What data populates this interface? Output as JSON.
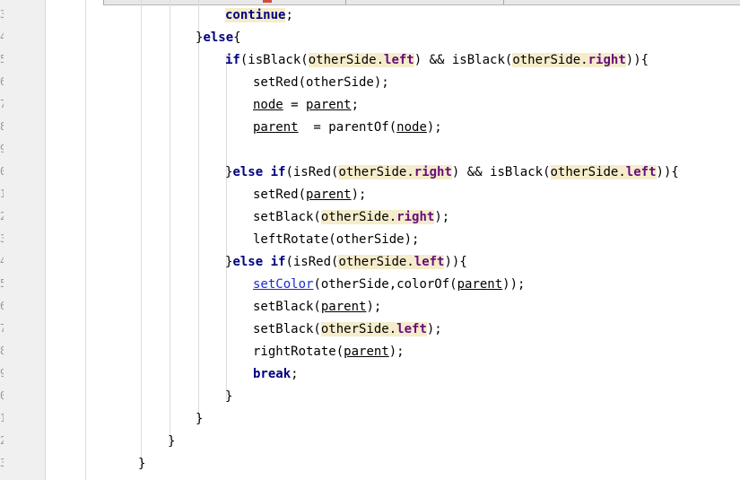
{
  "editor": {
    "gutter": {
      "line_numbers": [
        "3",
        "4",
        "5",
        "6",
        "7",
        "8",
        "9",
        "0",
        "1",
        "2",
        "3",
        "4",
        "5",
        "6",
        "7",
        "8",
        "9",
        "0",
        "1",
        "2",
        "3"
      ]
    },
    "code_lines": [
      {
        "tokens": [
          {
            "t": "continue",
            "c": "kw hl"
          },
          {
            "t": ";"
          }
        ]
      },
      {
        "tokens": [
          {
            "t": "}"
          },
          {
            "t": "else",
            "c": "kw"
          },
          {
            "t": "{"
          }
        ]
      },
      {
        "tokens": [
          {
            "t": "if",
            "c": "kw"
          },
          {
            "t": "(isBlack("
          },
          {
            "t": "otherSide.",
            "c": "hl"
          },
          {
            "t": "left",
            "c": "fld hl"
          },
          {
            "t": ") && isBlack("
          },
          {
            "t": "otherSide.",
            "c": "hl"
          },
          {
            "t": "right",
            "c": "fld hl"
          },
          {
            "t": ")){"
          }
        ]
      },
      {
        "tokens": [
          {
            "t": "setRed(otherSide);"
          }
        ]
      },
      {
        "tokens": [
          {
            "t": "node",
            "c": "u"
          },
          {
            "t": " = "
          },
          {
            "t": "parent",
            "c": "u"
          },
          {
            "t": ";"
          }
        ]
      },
      {
        "tokens": [
          {
            "t": "parent",
            "c": "u"
          },
          {
            "t": "  = parentOf("
          },
          {
            "t": "node",
            "c": "u"
          },
          {
            "t": ");"
          }
        ]
      },
      {
        "tokens": []
      },
      {
        "tokens": [
          {
            "t": "}"
          },
          {
            "t": "else if",
            "c": "kw"
          },
          {
            "t": "(isRed("
          },
          {
            "t": "otherSide.",
            "c": "hl"
          },
          {
            "t": "right",
            "c": "fld hl"
          },
          {
            "t": ") && isBlack("
          },
          {
            "t": "otherSide.",
            "c": "hl"
          },
          {
            "t": "left",
            "c": "fld hl"
          },
          {
            "t": ")){"
          }
        ]
      },
      {
        "tokens": [
          {
            "t": "setRed("
          },
          {
            "t": "parent",
            "c": "u"
          },
          {
            "t": ");"
          }
        ]
      },
      {
        "tokens": [
          {
            "t": "setBlack("
          },
          {
            "t": "otherSide.",
            "c": "hl"
          },
          {
            "t": "right",
            "c": "fld hl"
          },
          {
            "t": ");"
          }
        ]
      },
      {
        "tokens": [
          {
            "t": "leftRotate(otherSide);"
          }
        ]
      },
      {
        "tokens": [
          {
            "t": "}"
          },
          {
            "t": "else if",
            "c": "kw"
          },
          {
            "t": "(isRed("
          },
          {
            "t": "otherSide.",
            "c": "hl"
          },
          {
            "t": "left",
            "c": "fld hl"
          },
          {
            "t": ")){"
          }
        ]
      },
      {
        "tokens": [
          {
            "t": "setColor",
            "c": "call"
          },
          {
            "t": "(otherSide,colorOf("
          },
          {
            "t": "parent",
            "c": "u"
          },
          {
            "t": "));"
          }
        ]
      },
      {
        "tokens": [
          {
            "t": "setBlack("
          },
          {
            "t": "parent",
            "c": "u"
          },
          {
            "t": ");"
          }
        ]
      },
      {
        "tokens": [
          {
            "t": "setBlack("
          },
          {
            "t": "otherSide.",
            "c": "hl"
          },
          {
            "t": "left",
            "c": "fld hl"
          },
          {
            "t": ");"
          }
        ]
      },
      {
        "tokens": [
          {
            "t": "rightRotate("
          },
          {
            "t": "parent",
            "c": "u"
          },
          {
            "t": ");"
          }
        ]
      },
      {
        "tokens": [
          {
            "t": "break",
            "c": "kw"
          },
          {
            "t": ";"
          }
        ]
      },
      {
        "tokens": [
          {
            "t": "}"
          }
        ]
      },
      {
        "tokens": [
          {
            "t": "}"
          }
        ]
      },
      {
        "tokens": [
          {
            "t": "}"
          }
        ]
      },
      {
        "tokens": [
          {
            "t": "}"
          }
        ]
      }
    ]
  },
  "colors": {
    "keyword": "#000080",
    "field": "#660e7a",
    "usage_highlight": "#f5eccb",
    "method_link": "#1a2ccf",
    "gutter_background": "#f0f0f0"
  }
}
